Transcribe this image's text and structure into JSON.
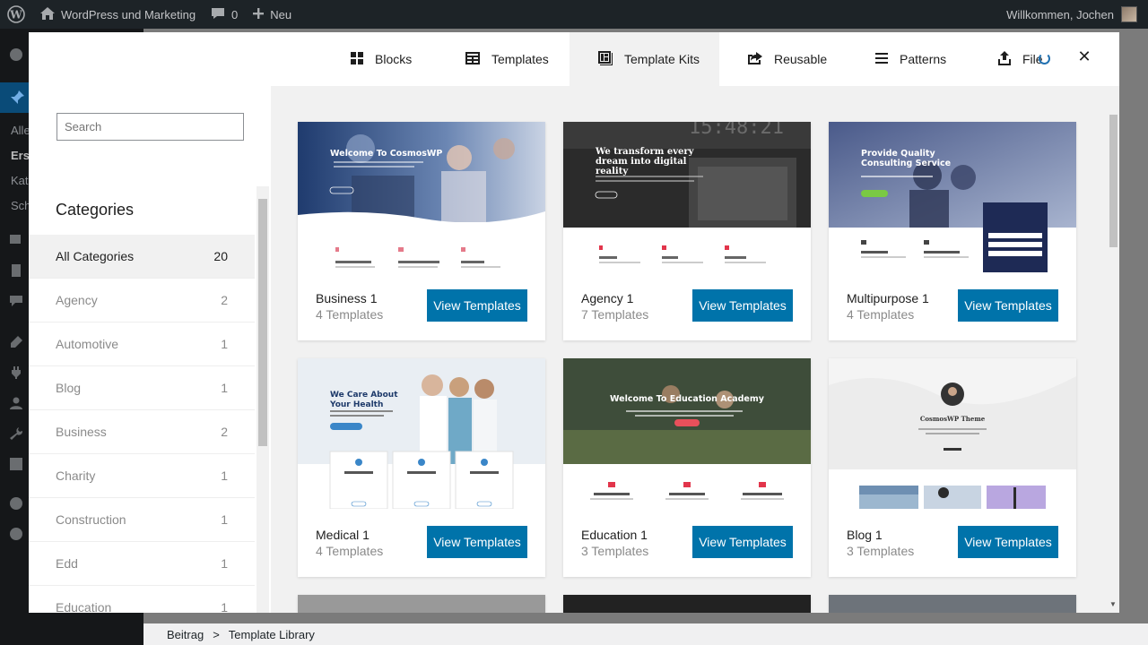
{
  "adminbar": {
    "site_name": "WordPress und Marketing",
    "comments_count": "0",
    "new_label": "Neu",
    "greeting": "Willkommen, Jochen"
  },
  "wp_sidebar": {
    "sub_items": [
      "Alle",
      "Erst",
      "Kate",
      "Schl"
    ]
  },
  "footer": {
    "crumb_1": "Beitrag",
    "separator": ">",
    "crumb_2": "Template Library"
  },
  "tabs": [
    {
      "label": "Blocks",
      "icon": "blocks-icon"
    },
    {
      "label": "Templates",
      "icon": "templates-icon"
    },
    {
      "label": "Template Kits",
      "icon": "template-kits-icon"
    },
    {
      "label": "Reusable",
      "icon": "reusable-icon"
    },
    {
      "label": "Patterns",
      "icon": "patterns-icon"
    },
    {
      "label": "File",
      "icon": "upload-icon"
    }
  ],
  "active_tab": "Template Kits",
  "close_glyph": "✕",
  "search": {
    "placeholder": "Search",
    "value": ""
  },
  "categories": {
    "title": "Categories",
    "items": [
      {
        "label": "All Categories",
        "count": "20"
      },
      {
        "label": "Agency",
        "count": "2"
      },
      {
        "label": "Automotive",
        "count": "1"
      },
      {
        "label": "Blog",
        "count": "1"
      },
      {
        "label": "Business",
        "count": "2"
      },
      {
        "label": "Charity",
        "count": "1"
      },
      {
        "label": "Construction",
        "count": "1"
      },
      {
        "label": "Edd",
        "count": "1"
      },
      {
        "label": "Education",
        "count": "1"
      }
    ]
  },
  "kits": [
    {
      "name": "Business 1",
      "count": "4 Templates",
      "button": "View Templates",
      "preview_title": "Welcome To CosmosWP"
    },
    {
      "name": "Agency 1",
      "count": "7 Templates",
      "button": "View Templates",
      "preview_title": "We transform every dream into digital reality",
      "preview_clock": "15:48:21"
    },
    {
      "name": "Multipurpose 1",
      "count": "4 Templates",
      "button": "View Templates",
      "preview_title": "Provide Quality Consulting Service"
    },
    {
      "name": "Medical 1",
      "count": "4 Templates",
      "button": "View Templates",
      "preview_title": "We Care About Your Health"
    },
    {
      "name": "Education 1",
      "count": "3 Templates",
      "button": "View Templates",
      "preview_title": "Welcome To Education Academy"
    },
    {
      "name": "Blog 1",
      "count": "3 Templates",
      "button": "View Templates",
      "preview_title": "CosmosWP Theme"
    }
  ],
  "colors": {
    "accent": "#0073aa",
    "admin_bar": "#1d2327"
  }
}
